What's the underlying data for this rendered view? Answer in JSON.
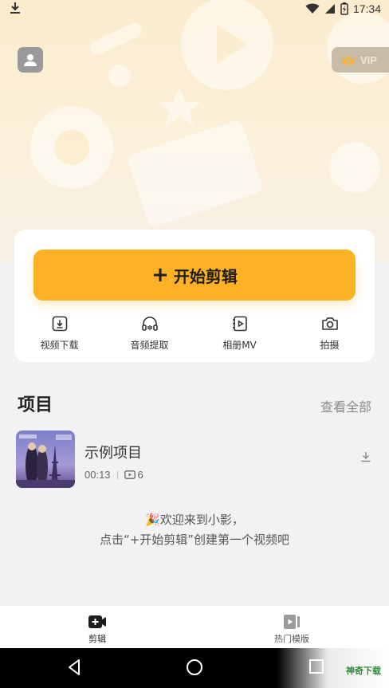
{
  "status_bar": {
    "time": "17:34",
    "download_icon": "download-icon",
    "icons": [
      "wifi-icon",
      "signal-icon",
      "battery-icon"
    ]
  },
  "header": {
    "avatar_icon": "user-icon",
    "vip_label": "VIP",
    "vip_icon": "crown-icon"
  },
  "main_card": {
    "start_button": {
      "plus": "+",
      "label": "开始剪辑"
    },
    "tools": [
      {
        "label": "视频下载",
        "icon": "video-download-icon"
      },
      {
        "label": "音频提取",
        "icon": "headphones-icon"
      },
      {
        "label": "相册MV",
        "icon": "album-mv-icon"
      },
      {
        "label": "拍摄",
        "icon": "camera-icon"
      }
    ]
  },
  "projects": {
    "title": "项目",
    "view_all": "查看全部",
    "items": [
      {
        "name": "示例项目",
        "duration": "00:13",
        "clip_count": "6"
      }
    ]
  },
  "welcome": {
    "line1": "🎉欢迎来到小影，",
    "line2": "点击“+开始剪辑”创建第一个视频吧"
  },
  "bottom_nav": {
    "items": [
      {
        "label": "剪辑",
        "icon": "video-add-icon",
        "active": true
      },
      {
        "label": "热门模版",
        "icon": "template-icon",
        "active": false
      }
    ]
  },
  "watermark": {
    "text": "神奇下载"
  },
  "colors": {
    "accent": "#fdb225",
    "hero_bg": "#fbeccd",
    "page_bg": "#f2f2f4",
    "vip_bg": "#c9bca6"
  }
}
